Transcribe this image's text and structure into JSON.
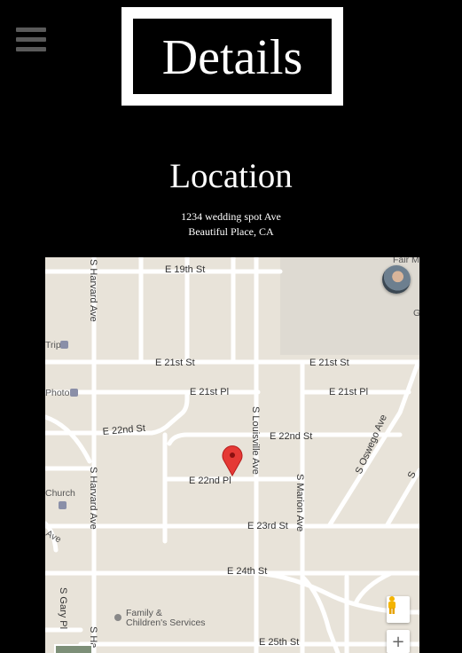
{
  "header": {
    "menu_icon": "hamburger-menu-icon",
    "title": "Details"
  },
  "location": {
    "heading": "Location",
    "address_line1": "1234 wedding spot Ave",
    "address_line2": "Beautiful Place, CA"
  },
  "map": {
    "labels": {
      "e19": "E 19th St",
      "e21_a": "E 21st St",
      "e21_b": "E 21st St",
      "e21pl_a": "E 21st Pl",
      "e21pl_b": "E 21st Pl",
      "e22_a": "E 22nd St",
      "e22_b": "E 22nd St",
      "e22pl": "E 22nd Pl",
      "e23": "E 23rd St",
      "e24": "E 24th St",
      "e25": "E 25th St",
      "harvard_top": "S Harvard Ave",
      "harvard_mid": "S Harvard Ave",
      "harvard_bot": "S Ha",
      "louisville": "S Louisville Ave",
      "marion": "S Marion Ave",
      "oswego": "S Oswego Ave",
      "gary": "S Gary Pl",
      "trip": "Trip",
      "photo": "Photo",
      "church": "Church",
      "ave": "Ave",
      "fair": "Fair M",
      "g": "G",
      "family1": "Family &",
      "family2": "Children's Services",
      "right_cut": "S"
    },
    "colors": {
      "background": "#e8e3d9",
      "road": "#ffffff",
      "block_gray": "#dedad2",
      "marker": "#e53935"
    },
    "controls": {
      "pegman_icon": "pegman-icon",
      "zoom_in": "+"
    }
  }
}
